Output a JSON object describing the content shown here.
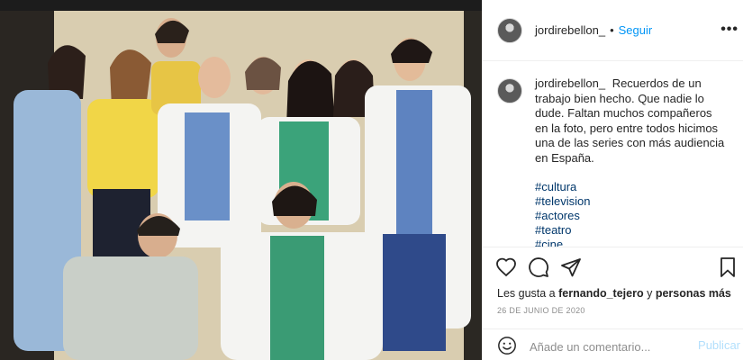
{
  "post": {
    "username": "jordirebellon_",
    "follow_label": "Seguir",
    "dot": "•",
    "more_label": "•••"
  },
  "caption": {
    "username": "jordirebellon_",
    "text": "Recuerdos de un trabajo bien hecho. Que nadie lo dude. Faltan muchos compañeros en la foto, pero entre todos hicimos una de las series con más audiencia en España.",
    "hashtags": [
      "#cultura",
      "#television",
      "#actores",
      "#teatro",
      "#cine"
    ]
  },
  "engagement": {
    "likes_prefix": "Les gusta a",
    "liker": "fernando_tejero",
    "likes_joiner": "y",
    "others": "personas más",
    "date": "26 DE JUNIO DE 2020"
  },
  "comment_box": {
    "placeholder": "Añade un comentario...",
    "publish_label": "Publicar"
  },
  "icons": {
    "like": "heart-icon",
    "comment": "comment-icon",
    "share": "share-icon",
    "save": "bookmark-icon",
    "emoji": "emoji-icon",
    "more": "more-icon"
  },
  "colors": {
    "link_blue": "#0095f6",
    "hashtag_blue": "#00376b",
    "publish_disabled": "#b2dffc",
    "muted_text": "#8e8e8e",
    "divider": "#efefef"
  }
}
